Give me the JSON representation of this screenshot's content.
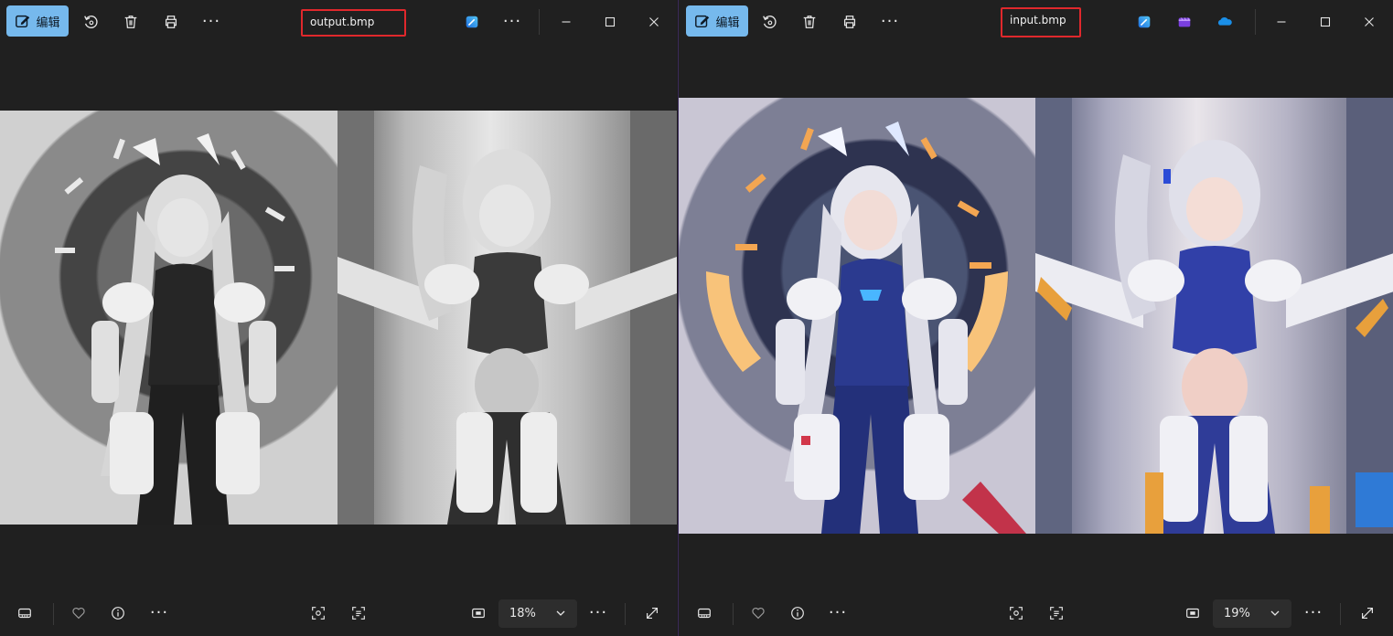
{
  "left_window": {
    "edit_label": "编辑",
    "filename": "output.bmp",
    "zoom": "18%",
    "image_mode": "grayscale"
  },
  "right_window": {
    "edit_label": "编辑",
    "filename": "input.bmp",
    "zoom": "19%",
    "image_mode": "color"
  },
  "icons": {
    "edit": "pencil-edit-icon",
    "rotate": "rotate-icon",
    "delete": "trash-icon",
    "print": "printer-icon",
    "more": "more-dots-icon",
    "designer": "designer-app-icon",
    "clipchamp": "clipchamp-icon",
    "onedrive": "onedrive-icon",
    "minimize": "minimize-icon",
    "maximize": "maximize-icon",
    "close": "close-icon",
    "filmstrip": "filmstrip-icon",
    "favorite": "heart-icon",
    "info": "info-icon",
    "crop_view": "scan-focus-icon",
    "text_detect": "text-scan-icon",
    "actual_size": "actual-size-icon",
    "fullscreen": "expand-icon"
  },
  "colors": {
    "edit_button_bg": "#76b9ed",
    "highlight_border": "#e0282c",
    "window_bg": "#202020"
  }
}
